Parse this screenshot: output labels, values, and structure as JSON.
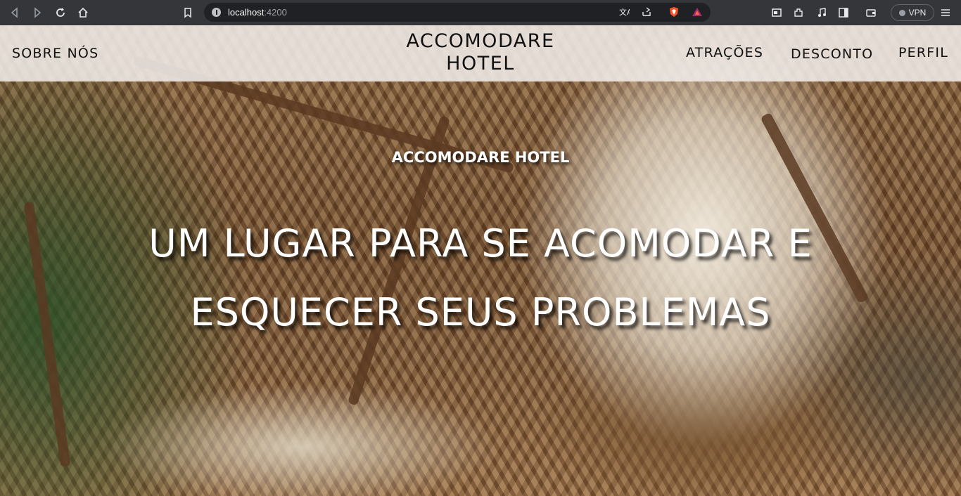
{
  "browser": {
    "url_host": "localhost",
    "url_port": ":4200",
    "vpn_label": "VPN",
    "icons": [
      "back-icon",
      "forward-icon",
      "reload-icon",
      "home-icon",
      "bookmark-icon",
      "translate-icon",
      "share-icon",
      "brave-shield-icon",
      "brave-rewards-icon",
      "tab-search-icon",
      "extensions-icon",
      "media-icon",
      "sidebar-icon",
      "wallet-icon",
      "menu-icon"
    ]
  },
  "navbar": {
    "left_link": "SOBRE NÓS",
    "brand_line1": "ACCOMODARE",
    "brand_line2": "HOTEL",
    "links": [
      "ATRAÇÕES",
      "DESCONTO",
      "PERFIL"
    ]
  },
  "hero": {
    "subtitle": "ACCOMODARE HOTEL",
    "title": "UM LUGAR PARA SE ACOMODAR E ESQUECER SEUS PROBLEMAS"
  }
}
